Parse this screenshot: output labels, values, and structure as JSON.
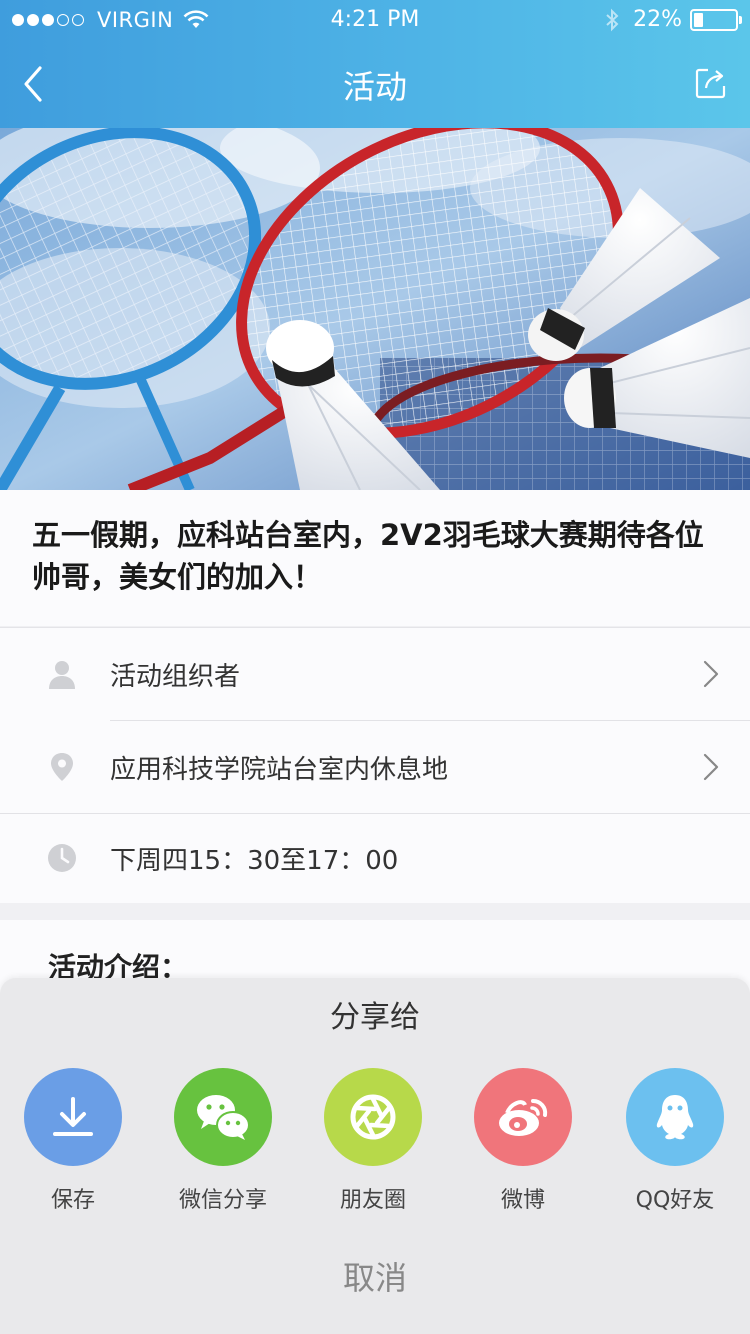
{
  "status_bar": {
    "carrier": "VIRGIN",
    "time": "4:21 PM",
    "battery": "22%",
    "battery_level": 0.22,
    "signal_bars_filled": 3,
    "signal_bars_total": 5
  },
  "nav": {
    "title": "活动",
    "back_icon": "chevron-left-icon",
    "share_icon": "share-icon"
  },
  "hero": {
    "image_icon": "badminton-rackets-shuttlecocks-photo"
  },
  "activity": {
    "headline": "五一假期，应科站台室内，2V2羽毛球大赛期待各位帅哥，美女们的加入！"
  },
  "info": {
    "organizer": "活动组织者",
    "location": "应用科技学院站台室内休息地",
    "time": "下周四15：30至17：00"
  },
  "intro": {
    "title": "活动介绍："
  },
  "share_sheet": {
    "title": "分享给",
    "items": [
      {
        "label": "保存",
        "icon": "download-icon",
        "color": "#6a9ee6"
      },
      {
        "label": "微信分享",
        "icon": "wechat-icon",
        "color": "#67c23f"
      },
      {
        "label": "朋友圈",
        "icon": "moments-icon",
        "color": "#b7d94a"
      },
      {
        "label": "微博",
        "icon": "weibo-icon",
        "color": "#f0757b"
      },
      {
        "label": "QQ好友",
        "icon": "qq-icon",
        "color": "#6cc0ef"
      }
    ],
    "cancel": "取消"
  }
}
